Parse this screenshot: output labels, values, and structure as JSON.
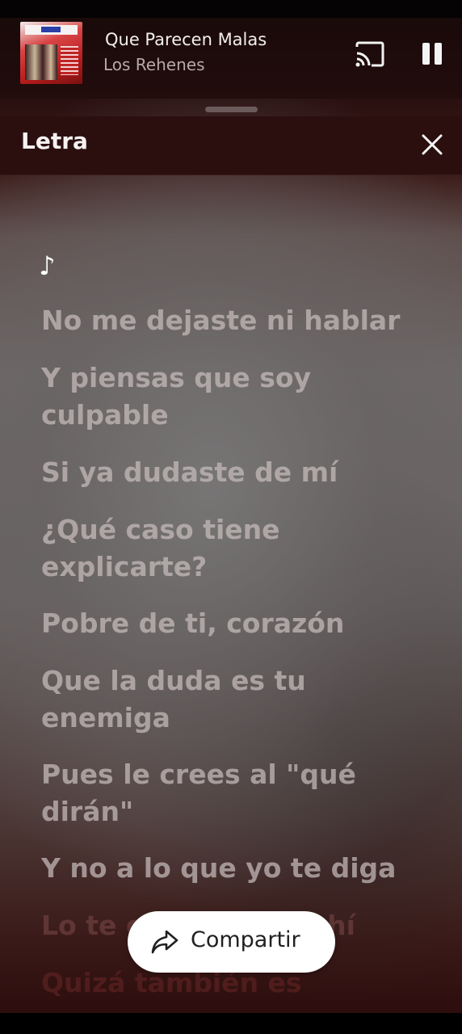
{
  "now_playing": {
    "title": "Que Parecen Malas",
    "artist": "Los Rehenes",
    "cast_icon": "cast-icon",
    "pause_icon": "pause-icon"
  },
  "lyrics_panel": {
    "title": "Letra",
    "close_icon": "close-icon",
    "note_symbol": "♪",
    "lines": [
      "No me dejaste ni hablar",
      "Y piensas que soy culpable",
      "Si ya dudaste de mí",
      "¿Qué caso tiene explicarte?",
      "Pobre de ti, corazón",
      "Que la duda es tu enemiga",
      "Pues le crees al \"qué dirán\"",
      "Y no a lo que yo te diga",
      "Lo te c                    hí",
      "Quizá también es"
    ]
  },
  "share": {
    "label": "Compartir",
    "icon": "share-icon"
  },
  "colors": {
    "background": "#1d0d0d",
    "header": "#2b0f0f",
    "lyric_text": "#c8bcbc",
    "button_bg": "#ffffff"
  }
}
